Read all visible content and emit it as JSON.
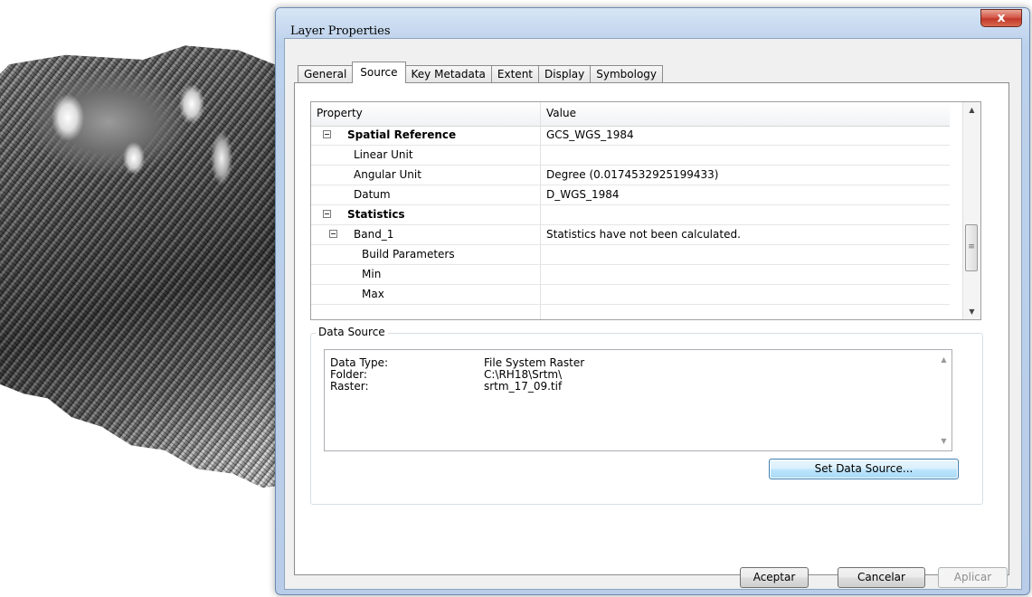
{
  "window": {
    "title": "Layer Properties",
    "close_label": "x"
  },
  "tabs": [
    {
      "label": "General"
    },
    {
      "label": "Source",
      "active": true
    },
    {
      "label": "Key Metadata"
    },
    {
      "label": "Extent"
    },
    {
      "label": "Display"
    },
    {
      "label": "Symbology"
    }
  ],
  "grid": {
    "header_property": "Property",
    "header_value": "Value",
    "rows": [
      {
        "property": "Spatial Reference",
        "value": "GCS_WGS_1984",
        "bold": true,
        "expander": true,
        "indent": 0
      },
      {
        "property": "Linear Unit",
        "value": "",
        "indent": 1
      },
      {
        "property": "Angular Unit",
        "value": "Degree (0.0174532925199433)",
        "indent": 1
      },
      {
        "property": "Datum",
        "value": "D_WGS_1984",
        "indent": 1
      },
      {
        "property": "Statistics",
        "value": "",
        "bold": true,
        "expander": true,
        "indent": 0
      },
      {
        "property": "Band_1",
        "value": "Statistics have not been calculated.",
        "expander": true,
        "indent": 1
      },
      {
        "property": "Build Parameters",
        "value": "",
        "indent": 2
      },
      {
        "property": "Min",
        "value": "",
        "indent": 2
      },
      {
        "property": "Max",
        "value": "",
        "indent": 2
      }
    ]
  },
  "data_source": {
    "title": "Data Source",
    "lines": [
      {
        "label": "Data Type:",
        "value": "File System Raster"
      },
      {
        "label": "Folder:",
        "value": "C:\\RH18\\Srtm\\"
      },
      {
        "label": "Raster:",
        "value": "srtm_17_09.tif"
      }
    ],
    "set_button": "Set Data Source..."
  },
  "buttons": {
    "ok": "Aceptar",
    "cancel": "Cancelar",
    "apply": "Aplicar"
  }
}
